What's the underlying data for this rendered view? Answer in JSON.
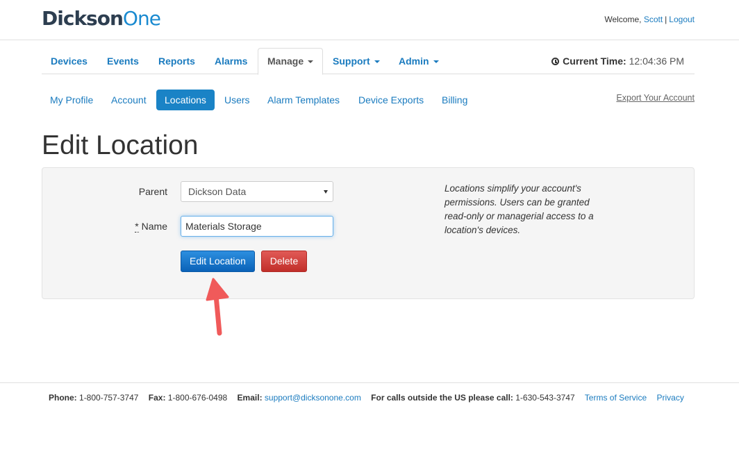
{
  "header": {
    "logo_part1": "Dickson",
    "logo_part2": "One",
    "welcome_prefix": "Welcome, ",
    "user_name": "Scott",
    "separator": "|",
    "logout_label": "Logout"
  },
  "main_nav": {
    "tabs": [
      {
        "label": "Devices"
      },
      {
        "label": "Events"
      },
      {
        "label": "Reports"
      },
      {
        "label": "Alarms"
      },
      {
        "label": "Manage",
        "active": true,
        "dropdown": true
      },
      {
        "label": "Support",
        "dropdown": true
      },
      {
        "label": "Admin",
        "dropdown": true
      }
    ],
    "current_time_label": "Current Time:",
    "current_time_value": "12:04:36 PM"
  },
  "sub_nav": {
    "items": [
      {
        "label": "My Profile"
      },
      {
        "label": "Account"
      },
      {
        "label": "Locations",
        "active": true
      },
      {
        "label": "Users"
      },
      {
        "label": "Alarm Templates"
      },
      {
        "label": "Device Exports"
      },
      {
        "label": "Billing"
      }
    ],
    "export_label": "Export Your Account"
  },
  "page_title": "Edit Location",
  "form": {
    "parent_label": "Parent",
    "parent_value": "Dickson Data",
    "required_marker": "*",
    "name_label": "Name",
    "name_value": "Materials Storage",
    "edit_button": "Edit Location",
    "delete_button": "Delete",
    "help_text": "Locations simplify your account's permissions. Users can be granted read-only or managerial access to a location's devices."
  },
  "footer": {
    "phone_label": "Phone:",
    "phone_value": "1-800-757-3747",
    "fax_label": "Fax:",
    "fax_value": "1-800-676-0498",
    "email_label": "Email:",
    "email_value": "support@dicksonone.com",
    "intl_label": "For calls outside the US please call:",
    "intl_value": "1-630-543-3747",
    "terms_label": "Terms of Service",
    "privacy_label": "Privacy"
  },
  "colors": {
    "link": "#1a7bbf",
    "active_pill": "#1a83c6",
    "primary_button": "#1065bd",
    "danger_button": "#d0403b",
    "annotation_arrow": "#f05a5a"
  }
}
